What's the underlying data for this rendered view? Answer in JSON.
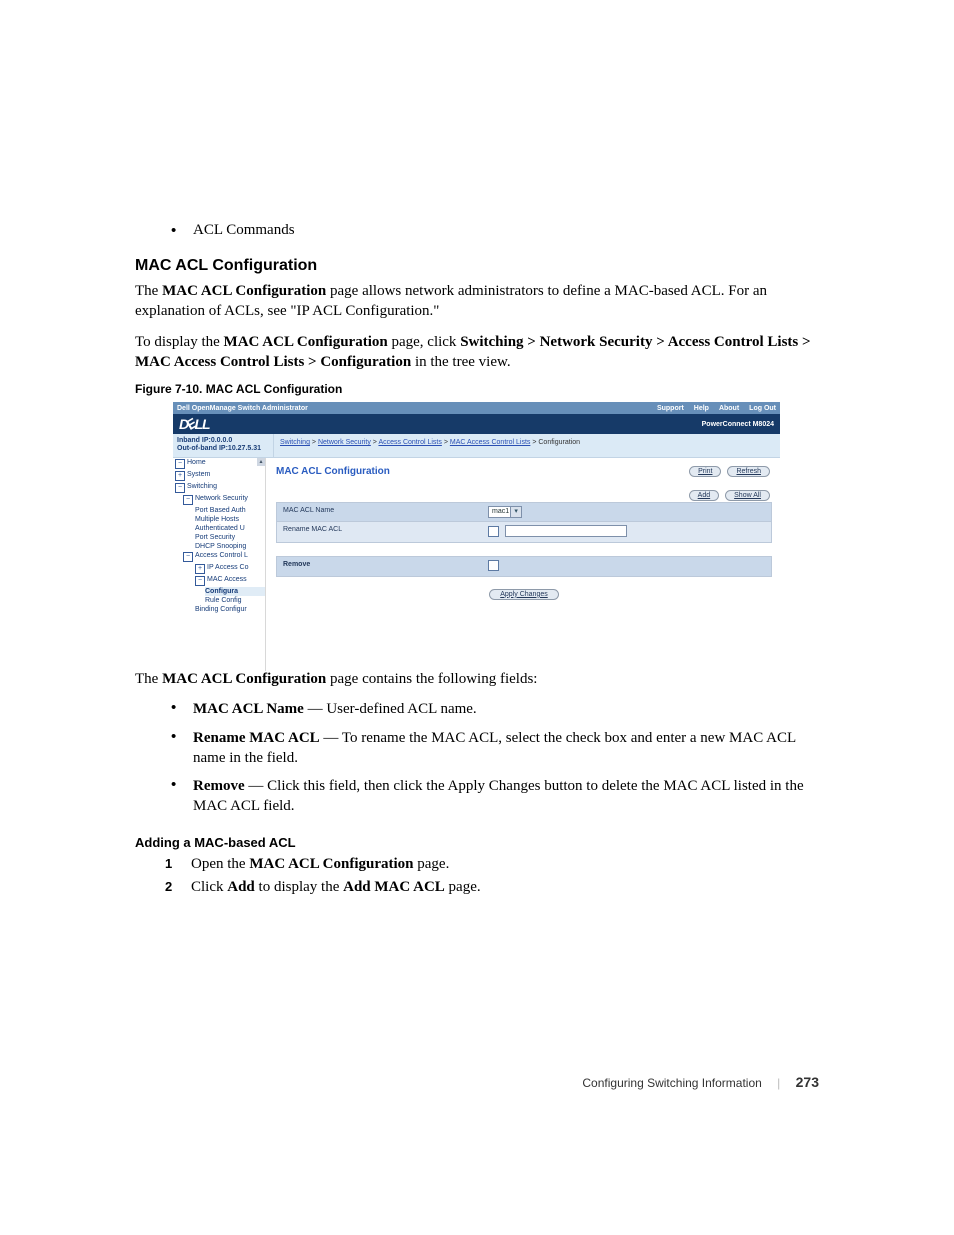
{
  "top_bullet": "ACL Commands",
  "h2": "MAC ACL Configuration",
  "para1_pre": "The ",
  "para1_b1": "MAC ACL Configuration",
  "para1_post": " page allows network administrators to define a MAC-based ACL. For an explanation of ACLs, see \"IP ACL Configuration.\"",
  "para2_pre": "To display the ",
  "para2_b1": "MAC ACL Configuration",
  "para2_mid": " page, click ",
  "para2_b2": "Switching > Network Security > Access Control Lists > MAC Access Control Lists > Configuration",
  "para2_post": " in the tree view.",
  "caption": "Figure 7-10.    MAC ACL Configuration",
  "emb": {
    "top_title": "Dell OpenManage Switch Administrator",
    "support": "Support",
    "help": "Help",
    "about": "About",
    "logout": "Log Out",
    "model": "PowerConnect M8024",
    "ip1": "Inband IP:0.0.0.0",
    "ip2": "Out-of-band IP:10.27.5.31",
    "bc_switching": "Switching",
    "bc_ns": "Network Security",
    "bc_acl": "Access Control Lists",
    "bc_mac": "MAC Access Control Lists",
    "bc_cfg": "Configuration",
    "tree": {
      "home": "Home",
      "system": "System",
      "switching": "Switching",
      "ns": "Network Security",
      "pba": "Port Based Auth",
      "mh": "Multiple Hosts",
      "au": "Authenticated U",
      "ps": "Port Security",
      "dhcp": "DHCP Snooping",
      "acl": "Access Control L",
      "ipacl": "IP Access Co",
      "macacl": "MAC Access",
      "config": "Configura",
      "rule": "Rule Config",
      "binding": "Binding Configur"
    },
    "title": "MAC ACL Configuration",
    "btn_print": "Print",
    "btn_refresh": "Refresh",
    "btn_add": "Add",
    "btn_showall": "Show All",
    "lbl_aclname": "MAC ACL Name",
    "sel_value": "mac1",
    "lbl_rename": "Rename MAC ACL",
    "lbl_remove": "Remove",
    "btn_apply": "Apply Changes"
  },
  "para3_pre": "The ",
  "para3_b": "MAC ACL Configuration",
  "para3_post": " page contains the following fields:",
  "fields": [
    {
      "term": "MAC ACL Name",
      "desc": " — User-defined ACL name."
    },
    {
      "term": "Rename MAC ACL",
      "desc": " — To rename the MAC ACL, select the check box and enter a new MAC ACL name in the field."
    },
    {
      "term": "Remove",
      "desc": " — Click this field, then click the Apply Changes button to delete the MAC ACL listed in the MAC ACL field."
    }
  ],
  "h3": "Adding a MAC-based ACL",
  "step1_pre": "Open the ",
  "step1_b": "MAC ACL Configuration",
  "step1_post": " page.",
  "step2_pre": "Click ",
  "step2_b1": "Add",
  "step2_mid": " to display the ",
  "step2_b2": "Add MAC ACL",
  "step2_post": " page.",
  "footer_section": "Configuring Switching Information",
  "footer_page": "273"
}
